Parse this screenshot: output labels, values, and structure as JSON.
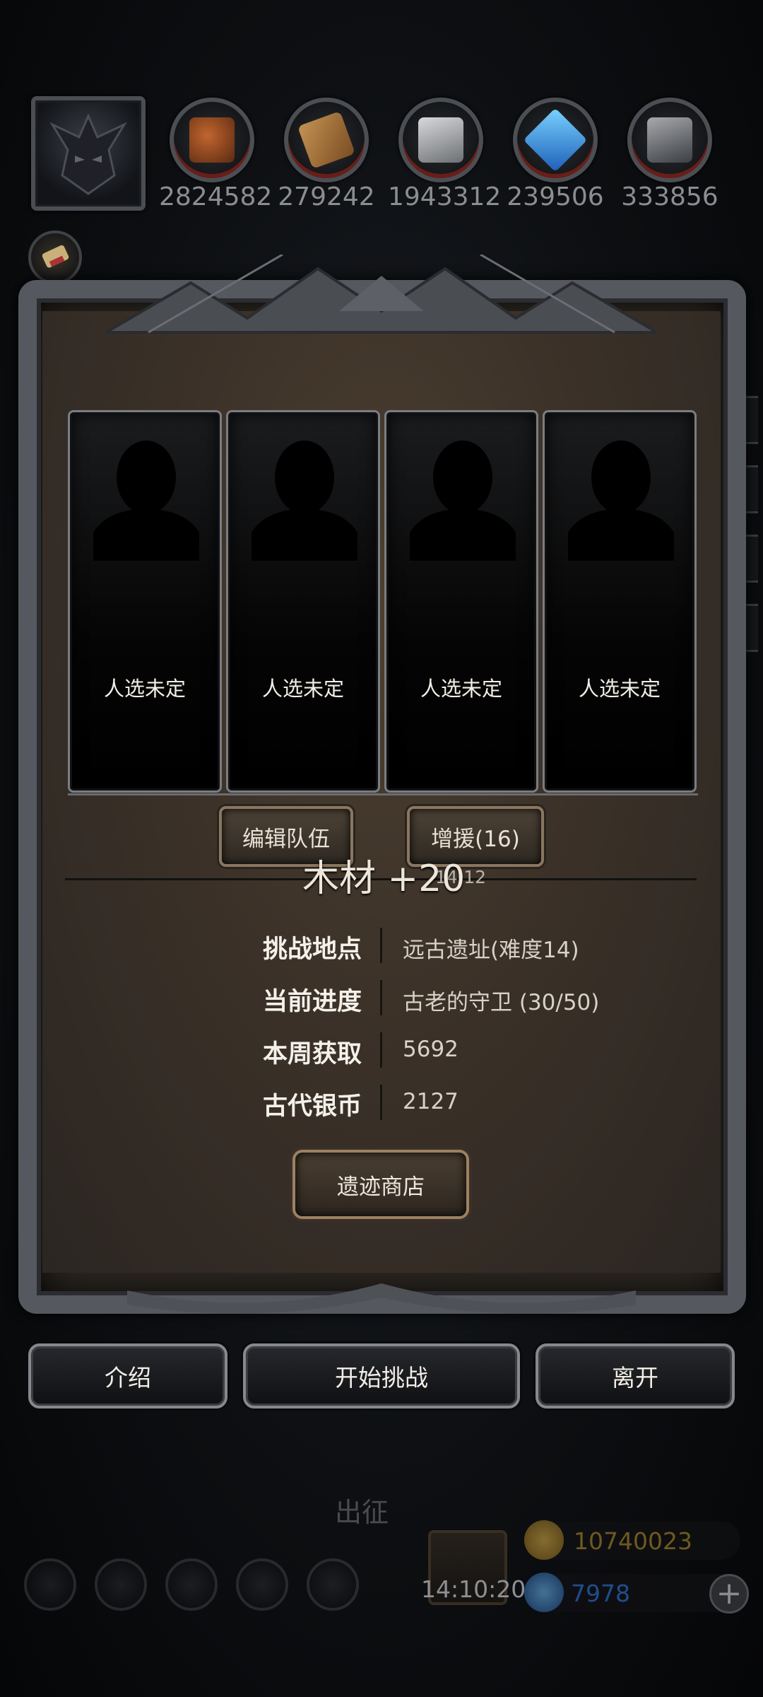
{
  "resources": [
    {
      "icon": "meat-icon",
      "value": "2824582"
    },
    {
      "icon": "wood-icon",
      "value": "279242"
    },
    {
      "icon": "iron-icon",
      "value": "1943312"
    },
    {
      "icon": "crystal-icon",
      "value": "239506"
    },
    {
      "icon": "steel-icon",
      "value": "333856"
    }
  ],
  "team_slots": [
    {
      "label": "人选未定"
    },
    {
      "label": "人选未定"
    },
    {
      "label": "人选未定"
    },
    {
      "label": "人选未定"
    }
  ],
  "team_buttons": {
    "edit_team": "编辑队伍",
    "reinforce": "增援(16)"
  },
  "floating_text": "木材 +20",
  "timer_overlay": "14:12",
  "info": [
    {
      "key": "挑战地点",
      "value": "远古遗址(难度14)"
    },
    {
      "key": "当前进度",
      "value": "古老的守卫 (30/50)"
    },
    {
      "key": "本周获取",
      "value": "5692"
    },
    {
      "key": "古代银币",
      "value": "2127"
    }
  ],
  "shop_button": "遗迹商店",
  "actions": {
    "intro": "介绍",
    "start": "开始挑战",
    "leave": "离开"
  },
  "background": {
    "dispatch_label": "出征",
    "gift_timer": "14:10:20",
    "gold": "10740023",
    "gems": "7978"
  },
  "colors": {
    "gold_text": "#6e5a1e",
    "gem_text": "#1f4d8c",
    "panel_brown": "#3b3128"
  }
}
